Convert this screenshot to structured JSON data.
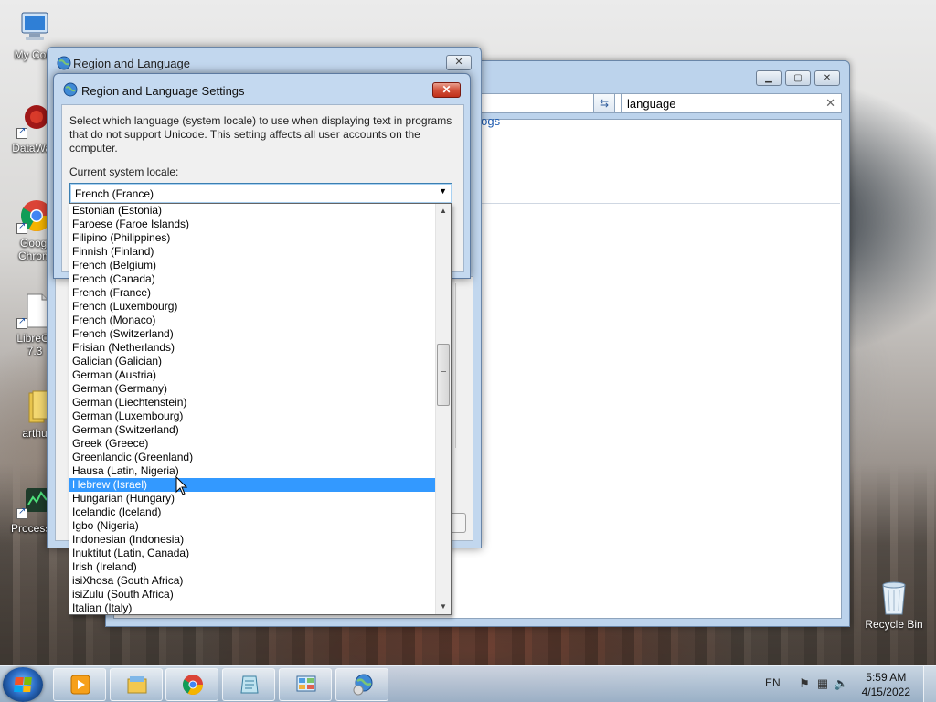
{
  "desktop": {
    "icons": [
      {
        "label": "My Com"
      },
      {
        "label": "DataWag"
      },
      {
        "label": "Googl\nChrom"
      },
      {
        "label": "LibreOf\n7.3"
      },
      {
        "label": "arthu"
      },
      {
        "label": "ProcessH"
      }
    ],
    "recycle_bin": "Recycle Bin"
  },
  "control_panel": {
    "search_value": "language",
    "link_fragment": "alogs"
  },
  "region_language": {
    "title": "Region and Language"
  },
  "settings_dialog": {
    "title": "Region and Language Settings",
    "description": "Select which language (system locale) to use when displaying text in programs that do not support Unicode. This setting affects all user accounts on the computer.",
    "current_label": "Current system locale:",
    "current_value": "French (France)"
  },
  "locale_list": {
    "selected": "Hebrew (Israel)",
    "items": [
      "Estonian (Estonia)",
      "Faroese (Faroe Islands)",
      "Filipino (Philippines)",
      "Finnish (Finland)",
      "French (Belgium)",
      "French (Canada)",
      "French (France)",
      "French (Luxembourg)",
      "French (Monaco)",
      "French (Switzerland)",
      "Frisian (Netherlands)",
      "Galician (Galician)",
      "German (Austria)",
      "German (Germany)",
      "German (Liechtenstein)",
      "German (Luxembourg)",
      "German (Switzerland)",
      "Greek (Greece)",
      "Greenlandic (Greenland)",
      "Hausa (Latin, Nigeria)",
      "Hebrew (Israel)",
      "Hungarian (Hungary)",
      "Icelandic (Iceland)",
      "Igbo (Nigeria)",
      "Indonesian (Indonesia)",
      "Inuktitut (Latin, Canada)",
      "Irish (Ireland)",
      "isiXhosa (South Africa)",
      "isiZulu (South Africa)",
      "Italian (Italy)"
    ]
  },
  "taskbar": {
    "language": "EN",
    "time": "5:59 AM",
    "date": "4/15/2022",
    "apps": [
      "media-player-icon",
      "file-explorer-icon",
      "chrome-icon",
      "notepad-icon",
      "control-panel-icon",
      "region-language-icon"
    ]
  },
  "colors": {
    "selection": "#3399ff",
    "close_button": "#c0301a",
    "link": "#1e5bb0"
  }
}
